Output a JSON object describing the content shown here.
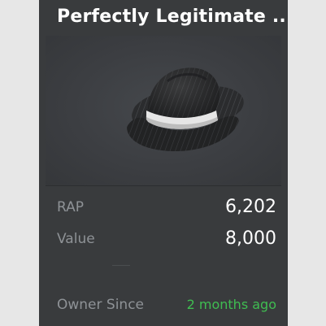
{
  "item": {
    "title": "Perfectly Legitimate ...",
    "thumbnail_icon": "fedora-hat-icon"
  },
  "stats": {
    "rap_label": "RAP",
    "rap_value": "6,202",
    "value_label": "Value",
    "value_value": "8,000",
    "owner_since_label": "Owner Since",
    "owner_since_value": "2 months ago"
  },
  "colors": {
    "card_background": "#393b3d",
    "page_background": "#e7e7e7",
    "label_gray": "#8e9296",
    "value_white": "#ffffff",
    "owner_since_green": "#3fbd51"
  }
}
